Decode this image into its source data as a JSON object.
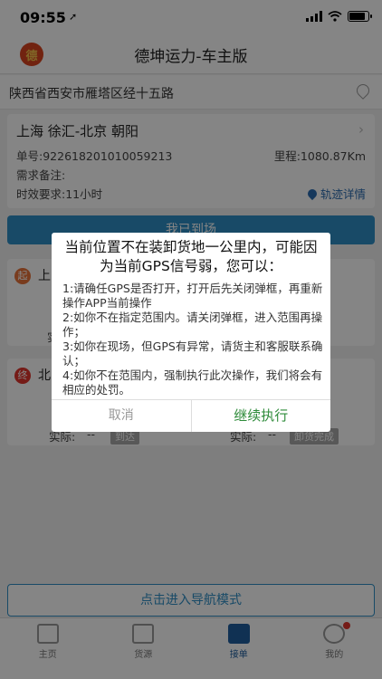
{
  "status_bar": {
    "time": "09:55",
    "location_arrow": "➚"
  },
  "header": {
    "logo_text": "德",
    "title": "德坤运力-车主版"
  },
  "location": {
    "address": "陕西省西安市雁塔区经十五路"
  },
  "order": {
    "route": "上海 徐汇-北京 朝阳",
    "number": "单号:922618201010059213",
    "mileage": "里程:1080.87Km",
    "remark": "需求备注:",
    "time_requirement": "时效要求:11小时",
    "track_label": "轨迹详情"
  },
  "arrive_button": "我已到场",
  "stops": [
    {
      "badge": "起",
      "city": "上",
      "actual": "实",
      "badge_color": "#e8733a"
    },
    {
      "badge": "终",
      "city": "北",
      "actual_label": "实际:",
      "actual_value": "--",
      "tag1": "到达",
      "actual_label2": "实际:",
      "actual_value2": "--",
      "tag2": "卸货完成",
      "badge_color": "#e0342c"
    }
  ],
  "navigation_button": "点击进入导航模式",
  "tabs": [
    {
      "label": "主页",
      "icon": "home-icon",
      "active": false
    },
    {
      "label": "货源",
      "icon": "cargo-icon",
      "active": false
    },
    {
      "label": "接单",
      "icon": "order-icon",
      "active": true
    },
    {
      "label": "我的",
      "icon": "profile-icon",
      "active": false
    }
  ],
  "dialog": {
    "title": "当前位置不在装卸货地一公里内，可能因为当前GPS信号弱，您可以：",
    "lines": [
      "1:请确任GPS是否打开，打开后先关闭弹框，再重新操作APP当前操作",
      "2:如你不在指定范围内。请关闭弹框，进入范围再操作；",
      "3:如你在现场，但GPS有异常，请货主和客服联系确认；",
      "4:如你不在范围内，强制执行此次操作，我们将会有相应的处罚。"
    ],
    "cancel_label": "取消",
    "continue_label": "继续执行"
  }
}
